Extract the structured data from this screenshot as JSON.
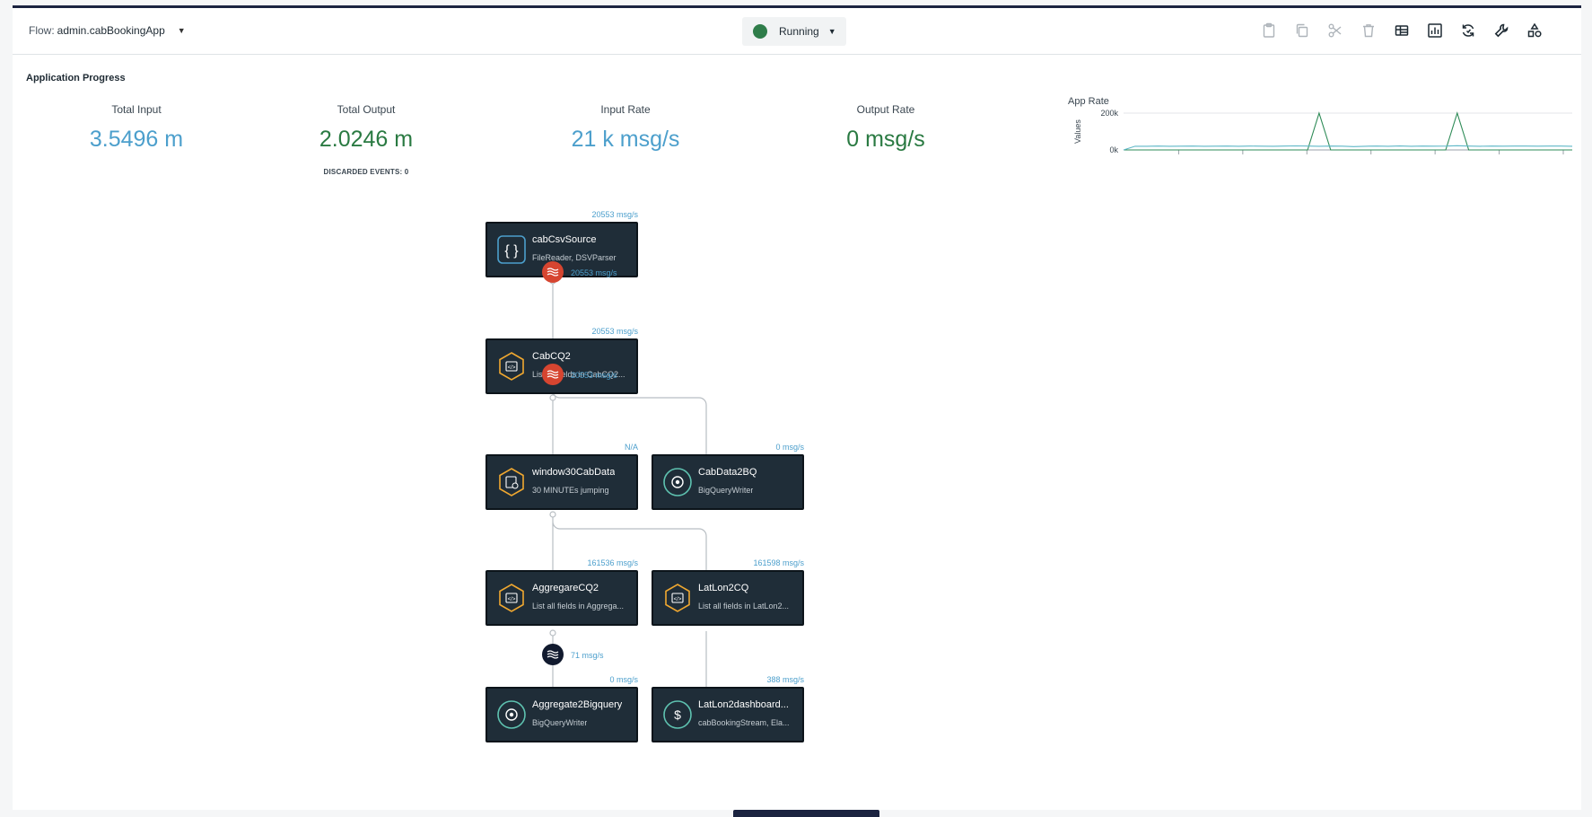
{
  "header": {
    "flow_prefix": "Flow:",
    "flow_name": "admin.cabBookingApp",
    "status_label": "Running",
    "status_color": "#2f7d4a",
    "toolbar_icons": [
      "clipboard-icon",
      "copy-icon",
      "cut-icon",
      "trash-icon",
      "table-icon",
      "bar-chart-icon",
      "refresh-icon",
      "wrench-icon",
      "shapes-icon"
    ]
  },
  "progress": {
    "title": "Application Progress",
    "metrics": [
      {
        "label": "Total Input",
        "value": "3.5496 m",
        "color": "blue"
      },
      {
        "label": "Total Output",
        "value": "2.0246 m",
        "color": "green"
      },
      {
        "label": "Input Rate",
        "value": "21 k msg/s",
        "color": "blue"
      },
      {
        "label": "Output Rate",
        "value": "0 msg/s",
        "color": "green"
      }
    ],
    "discarded": "DISCARDED EVENTS: 0"
  },
  "chart_data": {
    "type": "line",
    "title": "App Rate",
    "ylabel": "Values",
    "ytick_labels": [
      "200k",
      "0k"
    ],
    "ylim": [
      0,
      200000
    ],
    "x": [
      1,
      2,
      3,
      4,
      5,
      6,
      7,
      8,
      9,
      10,
      11,
      12,
      13,
      14,
      15,
      16,
      17,
      18,
      19,
      20,
      21,
      22,
      23,
      24,
      25,
      26,
      27,
      28,
      29,
      30,
      31,
      32,
      33,
      34,
      35,
      36,
      37,
      38,
      39,
      40
    ],
    "series": [
      {
        "color": "#2e8b57",
        "values": [
          0,
          0,
          0,
          0,
          0,
          0,
          0,
          0,
          0,
          0,
          0,
          0,
          0,
          0,
          0,
          0,
          0,
          200000,
          0,
          0,
          0,
          0,
          0,
          0,
          0,
          0,
          0,
          0,
          0,
          200000,
          0,
          0,
          0,
          0,
          0,
          0,
          0,
          0,
          0,
          0
        ]
      },
      {
        "color": "#5fb8c8",
        "values": [
          0,
          20000,
          20000,
          21000,
          20000,
          20500,
          21000,
          20000,
          20500,
          21000,
          20000,
          21000,
          20500,
          20000,
          21000,
          22000,
          21000,
          20000,
          21000,
          20500,
          18000,
          20000,
          21000,
          20000,
          21500,
          20000,
          21000,
          20500,
          21000,
          23000,
          21000,
          20000,
          21000,
          20500,
          21000,
          21000,
          20500,
          21000,
          21000,
          20000
        ]
      }
    ]
  },
  "graph": {
    "nodes": [
      {
        "id": "n1",
        "title": "cabCsvSource",
        "subtitle": "FileReader, DSVParser",
        "rate": "20553 msg/s",
        "icon": "braces-icon"
      },
      {
        "id": "n2",
        "title": "CabCQ2",
        "subtitle": "List all fields in CabCQ2...",
        "rate": "20553 msg/s",
        "icon": "code-hexagon-icon"
      },
      {
        "id": "n3",
        "title": "window30CabData",
        "subtitle": "30 MINUTEs jumping",
        "rate": "N/A",
        "icon": "window-hexagon-icon"
      },
      {
        "id": "n4",
        "title": "CabData2BQ",
        "subtitle": "BigQueryWriter",
        "rate": "0 msg/s",
        "icon": "target-circle-icon"
      },
      {
        "id": "n5",
        "title": "AggregareCQ2",
        "subtitle": "List all fields in Aggrega...",
        "rate": "161536 msg/s",
        "icon": "code-hexagon-icon"
      },
      {
        "id": "n6",
        "title": "LatLon2CQ",
        "subtitle": "List all fields in LatLon2...",
        "rate": "161598 msg/s",
        "icon": "code-hexagon-icon"
      },
      {
        "id": "n7",
        "title": "Aggregate2Bigquery",
        "subtitle": "BigQueryWriter",
        "rate": "0 msg/s",
        "icon": "target-circle-icon"
      },
      {
        "id": "n8",
        "title": "LatLon2dashboard...",
        "subtitle": "cabBookingStream, Ela...",
        "rate": "388 msg/s",
        "icon": "dollar-circle-icon"
      }
    ],
    "streams": [
      {
        "rate": "20553 msg/s",
        "color": "#d64530"
      },
      {
        "rate": "20553 msg/s",
        "color": "#d64530"
      },
      {
        "rate": "71 msg/s",
        "color": "#111a2e"
      }
    ]
  }
}
